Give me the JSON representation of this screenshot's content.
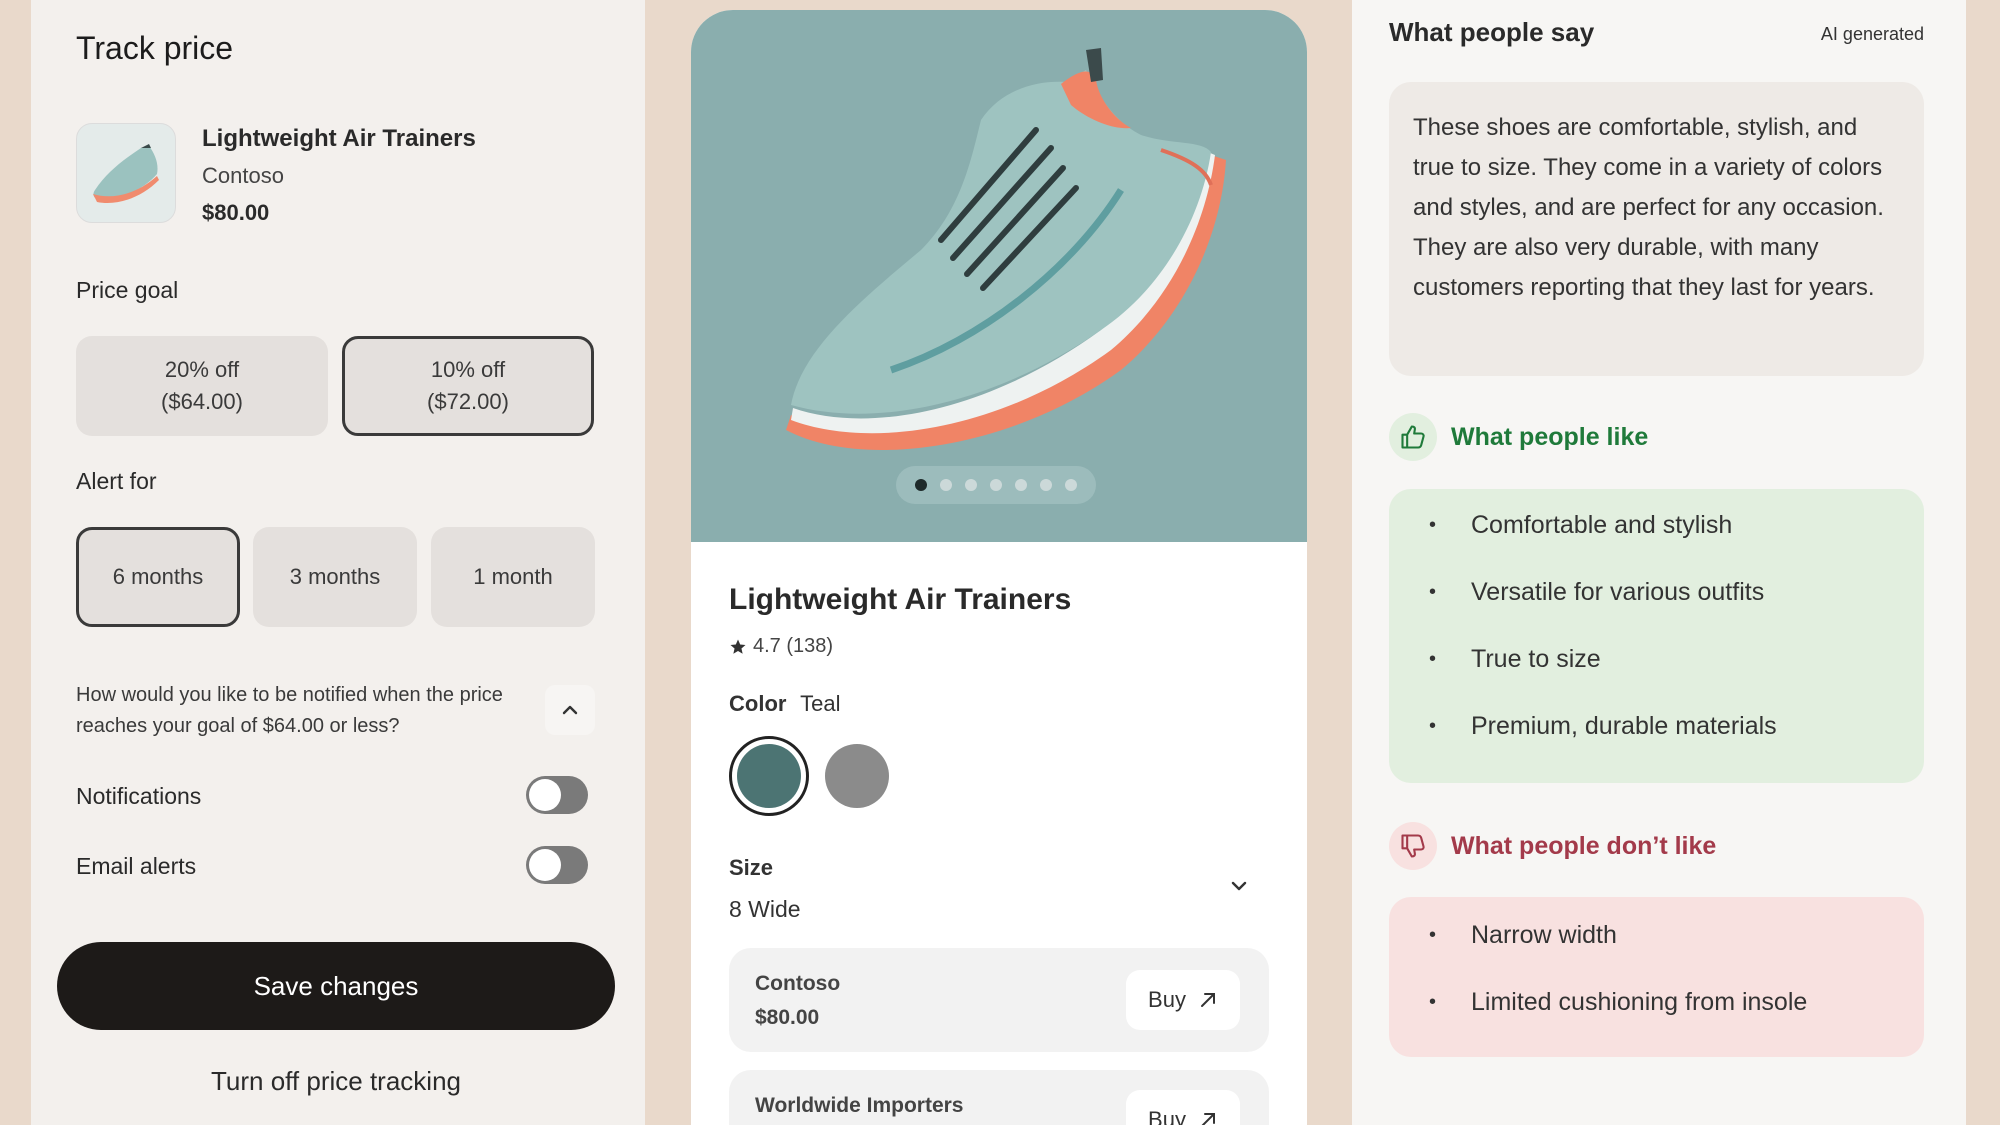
{
  "track_price": {
    "title": "Track price",
    "product": {
      "name": "Lightweight Air Trainers",
      "brand": "Contoso",
      "price": "$80.00"
    },
    "price_goal": {
      "label": "Price goal",
      "options": [
        {
          "line1": "20% off",
          "line2": "($64.00)"
        },
        {
          "line1": "10% off",
          "line2": "($72.00)"
        }
      ]
    },
    "alert_for": {
      "label": "Alert for",
      "options": [
        "6 months",
        "3 months",
        "1 month"
      ]
    },
    "notify_question": "How would you like to be notified when the price reaches your goal of $64.00 or less?",
    "notifications_label": "Notifications",
    "notifications_on": false,
    "email_alerts_label": "Email alerts",
    "email_alerts_on": false,
    "save_label": "Save changes",
    "turn_off_label": "Turn off price tracking"
  },
  "product_detail": {
    "name": "Lightweight Air Trainers",
    "rating": "4.7 (138)",
    "color_label": "Color",
    "color_value": "Teal",
    "swatches": [
      "#4c7473",
      "#8b8b8b"
    ],
    "size_label": "Size",
    "size_value": "8 Wide",
    "carousel_total": 7,
    "carousel_active": 1,
    "sellers": [
      {
        "name": "Contoso",
        "price": "$80.00",
        "buy": "Buy"
      },
      {
        "name": "Worldwide Importers",
        "price": "",
        "buy": "Buy"
      }
    ]
  },
  "reviews": {
    "title": "What people say",
    "ai_tag": "AI generated",
    "summary": "These shoes are comfortable, stylish, and true to size. They come in a variety of colors and styles, and are perfect for any occasion. They are also very durable, with many customers reporting that they last for years.",
    "likes_title": "What people like",
    "likes": [
      "Comfortable and stylish",
      "Versatile for various outfits",
      "True to size",
      "Premium, durable materials"
    ],
    "dislikes_title": "What people don’t like",
    "dislikes": [
      "Narrow width",
      "Limited cushioning from insole"
    ]
  },
  "colors": {
    "like_green": "#1f7a3a",
    "dislike_red": "#a33a4a",
    "hero_teal": "#8aaeae"
  }
}
